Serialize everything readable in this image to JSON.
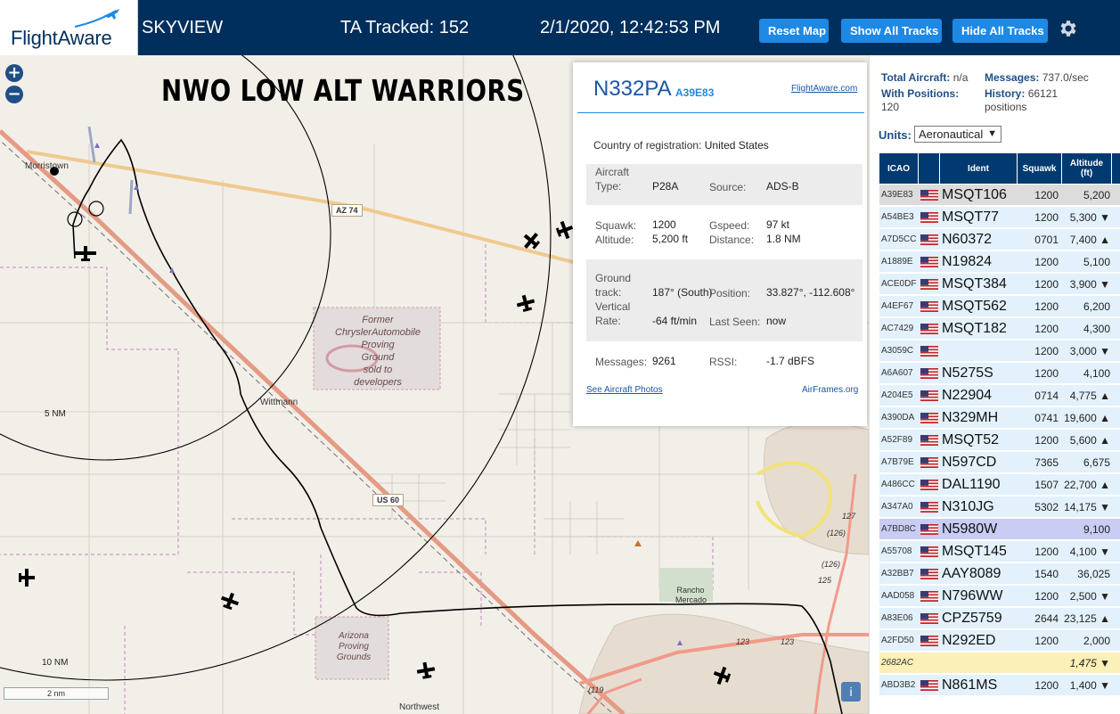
{
  "header": {
    "logo_text": "FlightAware",
    "app_name": "SKYVIEW",
    "tracked": "TA Tracked: 152",
    "datetime": "2/1/2020, 12:42:53 PM",
    "buttons": {
      "reset": "Reset Map",
      "show": "Show All Tracks",
      "hide": "Hide All Tracks"
    }
  },
  "map": {
    "overlay_title": "NWO LOW ALT WARRIORS",
    "zoom_in": "+",
    "zoom_out": "−",
    "places": {
      "morristown": "Morristown",
      "wittmann": "Wittmann",
      "rancho_mercado": "Rancho Mercado",
      "northwest": "Northwest",
      "az74": "AZ 74",
      "us60": "US 60",
      "r127": "127",
      "r126a": "(126)",
      "r126b": "(126)",
      "r125": "125",
      "r123a": "123",
      "r123b": "123",
      "r119": "(119"
    },
    "former_chrysler": [
      "Former",
      "ChryslerAutomobile",
      "Proving",
      "Ground",
      "sold to",
      "developers"
    ],
    "arizona_proving": [
      "Arizona",
      "Proving",
      "Grounds"
    ],
    "ring_5": "5 NM",
    "ring_10": "10 NM",
    "scale": "2 nm",
    "info": "i"
  },
  "popup": {
    "registration": "N332PA",
    "hex": "A39E83",
    "fa_link": "FlightAware.com",
    "country_label": "Country of registration:",
    "country_value": "United States",
    "aircraft_type_label_1": "Aircraft",
    "aircraft_type_label_2": "Type:",
    "aircraft_type": "P28A",
    "source_label": "Source:",
    "source": "ADS-B",
    "squawk_label": "Squawk:",
    "squawk": "1200",
    "gspeed_label": "Gspeed:",
    "gspeed": "97 kt",
    "altitude_label": "Altitude:",
    "altitude": "5,200 ft",
    "distance_label": "Distance:",
    "distance": "1.8 NM",
    "ground_track_label_1": "Ground",
    "ground_track_label_2": "track:",
    "ground_track": "187° (South)",
    "position_label": "Position:",
    "position": "33.827°, -112.608°",
    "vertical_rate_label_1": "Vertical",
    "vertical_rate_label_2": "Rate:",
    "vertical_rate": "-64 ft/min",
    "last_seen_label": "Last Seen:",
    "last_seen": "now",
    "messages_label": "Messages:",
    "messages": "9261",
    "rssi_label": "RSSI:",
    "rssi": "-1.7 dBFS",
    "photos_link": "See Aircraft Photos",
    "airframes_link": "AirFrames.org"
  },
  "sidebar": {
    "total_aircraft_label": "Total Aircraft:",
    "total_aircraft": "n/a",
    "messages_label": "Messages:",
    "messages": "737.0/sec",
    "with_positions_label": "With Positions:",
    "with_positions": "120",
    "history_label": "History:",
    "history": "66121",
    "history_unit": "positions",
    "units_label": "Units:",
    "units_value": "Aeronautical",
    "columns": {
      "icao": "ICAO",
      "ident": "Ident",
      "squawk": "Squawk",
      "altitude_1": "Altitude",
      "altitude_2": "(ft)"
    },
    "rows": [
      {
        "icao": "A39E83",
        "ident": "MSQT106",
        "squawk": "1200",
        "alt": "5,200",
        "flag": true,
        "bg": "#dcdcdc"
      },
      {
        "icao": "A54BE3",
        "ident": "MSQT77",
        "squawk": "1200",
        "alt": "5,300 ▼",
        "flag": true,
        "bg": "#e2f1fb"
      },
      {
        "icao": "A7D5CC",
        "ident": "N60372",
        "squawk": "0701",
        "alt": "7,400 ▲",
        "flag": true,
        "bg": "#e2f1fb"
      },
      {
        "icao": "A1889E",
        "ident": "N19824",
        "squawk": "1200",
        "alt": "5,100",
        "flag": true,
        "bg": "#e2f1fb"
      },
      {
        "icao": "ACE0DF",
        "ident": "MSQT384",
        "squawk": "1200",
        "alt": "3,900 ▼",
        "flag": true,
        "bg": "#e2f1fb"
      },
      {
        "icao": "A4EF67",
        "ident": "MSQT562",
        "squawk": "1200",
        "alt": "6,200",
        "flag": true,
        "bg": "#e2f1fb"
      },
      {
        "icao": "AC7429",
        "ident": "MSQT182",
        "squawk": "1200",
        "alt": "4,300",
        "flag": true,
        "bg": "#e2f1fb"
      },
      {
        "icao": "A3059C",
        "ident": "",
        "squawk": "1200",
        "alt": "3,000 ▼",
        "flag": true,
        "bg": "#e2f1fb"
      },
      {
        "icao": "A6A607",
        "ident": "N5275S",
        "squawk": "1200",
        "alt": "4,100",
        "flag": true,
        "bg": "#e2f1fb"
      },
      {
        "icao": "A204E5",
        "ident": "N22904",
        "squawk": "0714",
        "alt": "4,775 ▲",
        "flag": true,
        "bg": "#e2f1fb"
      },
      {
        "icao": "A390DA",
        "ident": "N329MH",
        "squawk": "0741",
        "alt": "19,600 ▲",
        "flag": true,
        "bg": "#e2f1fb"
      },
      {
        "icao": "A52F89",
        "ident": "MSQT52",
        "squawk": "1200",
        "alt": "5,600 ▲",
        "flag": true,
        "bg": "#e2f1fb"
      },
      {
        "icao": "A7B79E",
        "ident": "N597CD",
        "squawk": "7365",
        "alt": "6,675",
        "flag": true,
        "bg": "#e2f1fb"
      },
      {
        "icao": "A486CC",
        "ident": "DAL1190",
        "squawk": "1507",
        "alt": "22,700 ▲",
        "flag": true,
        "bg": "#e2f1fb"
      },
      {
        "icao": "A347A0",
        "ident": "N310JG",
        "squawk": "5302",
        "alt": "14,175 ▼",
        "flag": true,
        "bg": "#e2f1fb"
      },
      {
        "icao": "A7BD8C",
        "ident": "N5980W",
        "squawk": "",
        "alt": "9,100",
        "flag": true,
        "bg": "#c9cdf3"
      },
      {
        "icao": "A55708",
        "ident": "MSQT145",
        "squawk": "1200",
        "alt": "4,100 ▼",
        "flag": true,
        "bg": "#e2f1fb"
      },
      {
        "icao": "A32BB7",
        "ident": "AAY8089",
        "squawk": "1540",
        "alt": "36,025",
        "flag": true,
        "bg": "#e2f1fb"
      },
      {
        "icao": "AAD058",
        "ident": "N796WW",
        "squawk": "1200",
        "alt": "2,500 ▼",
        "flag": true,
        "bg": "#e2f1fb"
      },
      {
        "icao": "A83E06",
        "ident": "CPZ5759",
        "squawk": "2644",
        "alt": "23,125 ▲",
        "flag": true,
        "bg": "#e2f1fb"
      },
      {
        "icao": "A2FD50",
        "ident": "N292ED",
        "squawk": "1200",
        "alt": "2,000",
        "flag": true,
        "bg": "#e2f1fb"
      },
      {
        "icao": "2682AC",
        "ident": "",
        "squawk": "",
        "alt": "1,475 ▼",
        "flag": false,
        "bg": "#fbf0b8"
      },
      {
        "icao": "ABD3B2",
        "ident": "N861MS",
        "squawk": "1200",
        "alt": "1,400 ▼",
        "flag": true,
        "bg": "#e2f1fb"
      }
    ]
  },
  "colors": {
    "header_bg": "#002f5d",
    "button_bg": "#1e88e5",
    "table_header": "#003a70",
    "row_bg": "#e2f1fb"
  }
}
